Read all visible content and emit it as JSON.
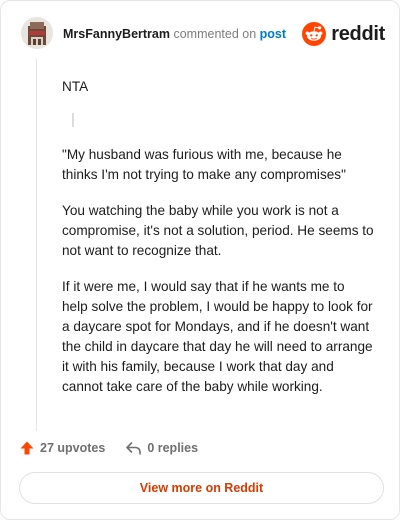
{
  "header": {
    "username": "MrsFannyBertram",
    "action": "commented on",
    "target": "post",
    "brand": "reddit"
  },
  "comment": {
    "verdict": "NTA",
    "quote": "\"My husband was furious with me, because he thinks I'm not trying to make any compromises\"",
    "paragraph_1": "You watching the baby while you work is not a compromise, it's not a solution, period. He seems to not want to recognize that.",
    "paragraph_2": "If it were me, I would say that if he wants me to help solve the problem, I would be happy to look for a daycare spot for Mondays, and if he doesn't want the child in daycare that day he will need to arrange it with his family, because I work that day and cannot take care of the baby while working."
  },
  "footer": {
    "upvotes": "27 upvotes",
    "replies": "0 replies"
  },
  "cta": {
    "label": "View more on Reddit"
  },
  "colors": {
    "brand_orange": "#ff4500",
    "link_blue": "#0079d3",
    "cta_text": "#d93a00"
  },
  "icons": [
    "avatar-image",
    "reddit-logo-icon",
    "upvote-arrow-icon",
    "reply-icon"
  ]
}
